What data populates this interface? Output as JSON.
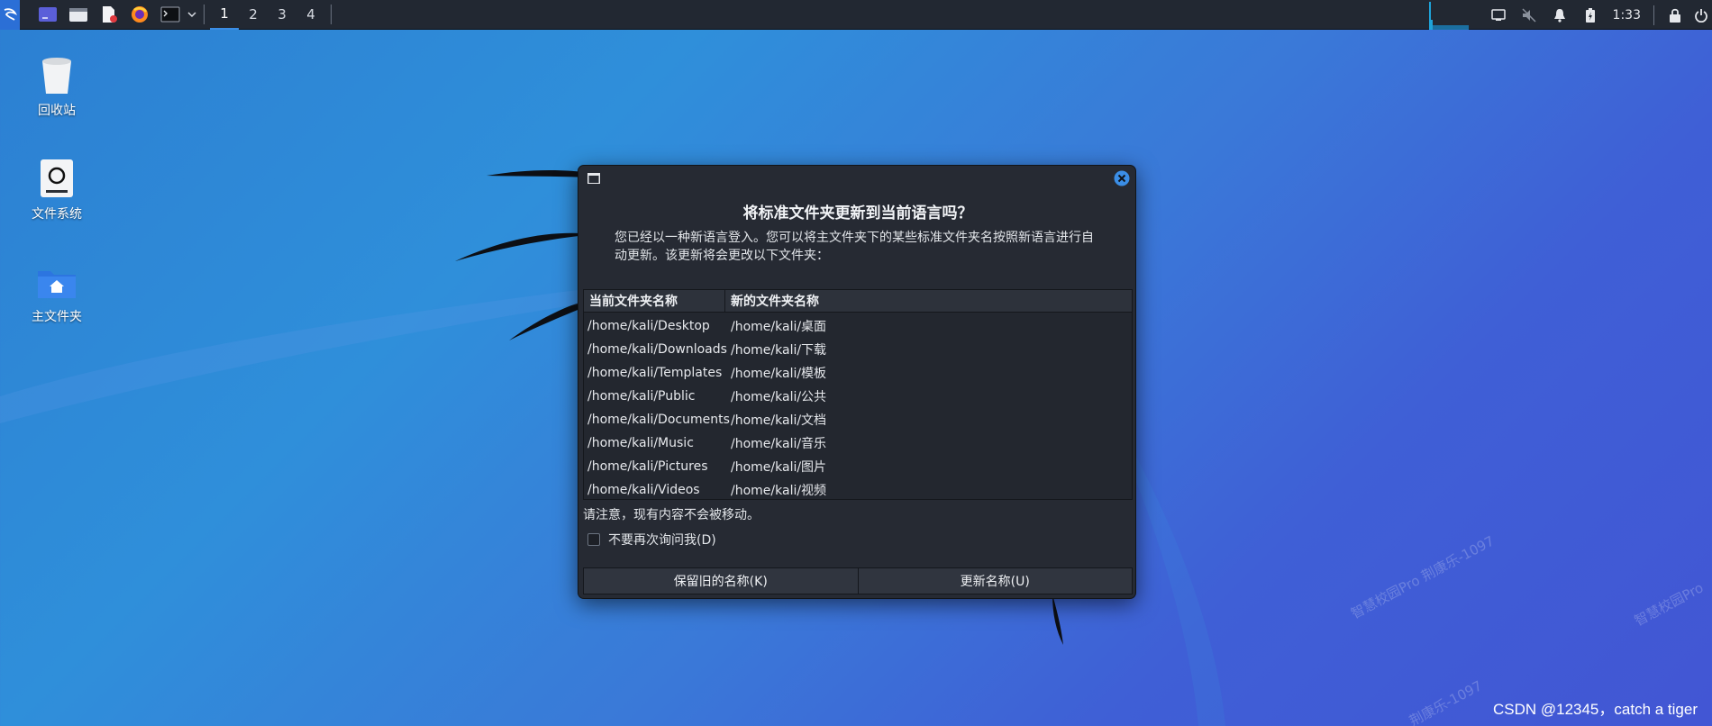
{
  "panel": {
    "workspaces": [
      "1",
      "2",
      "3",
      "4"
    ],
    "active_workspace": 0,
    "clock": "1:33"
  },
  "desktop": {
    "trash_label": "回收站",
    "filesystem_label": "文件系统",
    "home_label": "主文件夹"
  },
  "dialog": {
    "title": "将标准文件夹更新到当前语言吗？",
    "description": "您已经以一种新语言登入。您可以将主文件夹下的某些标准文件夹名按照新语言进行自动更新。该更新将会更改以下文件夹：",
    "columns": [
      "当前文件夹名称",
      "新的文件夹名称"
    ],
    "rows": [
      [
        "/home/kali/Desktop",
        "/home/kali/桌面"
      ],
      [
        "/home/kali/Downloads",
        "/home/kali/下载"
      ],
      [
        "/home/kali/Templates",
        "/home/kali/模板"
      ],
      [
        "/home/kali/Public",
        "/home/kali/公共"
      ],
      [
        "/home/kali/Documents",
        "/home/kali/文档"
      ],
      [
        "/home/kali/Music",
        "/home/kali/音乐"
      ],
      [
        "/home/kali/Pictures",
        "/home/kali/图片"
      ],
      [
        "/home/kali/Videos",
        "/home/kali/视频"
      ]
    ],
    "note": "请注意，现有内容不会被移动。",
    "dont_ask_label": "不要再次询问我(D)",
    "dont_ask_checked": false,
    "keep_button": "保留旧的名称(K)",
    "update_button": "更新名称(U)"
  },
  "watermarks": [
    "智慧校园Pro 荆康乐-1097",
    "智慧校园Pro",
    "荆康乐-1097"
  ],
  "credit": "CSDN @12345，catch a tiger",
  "colors": {
    "accent": "#3b8ee6",
    "dialog_bg": "#262a33",
    "panel_bg": "#222832"
  }
}
